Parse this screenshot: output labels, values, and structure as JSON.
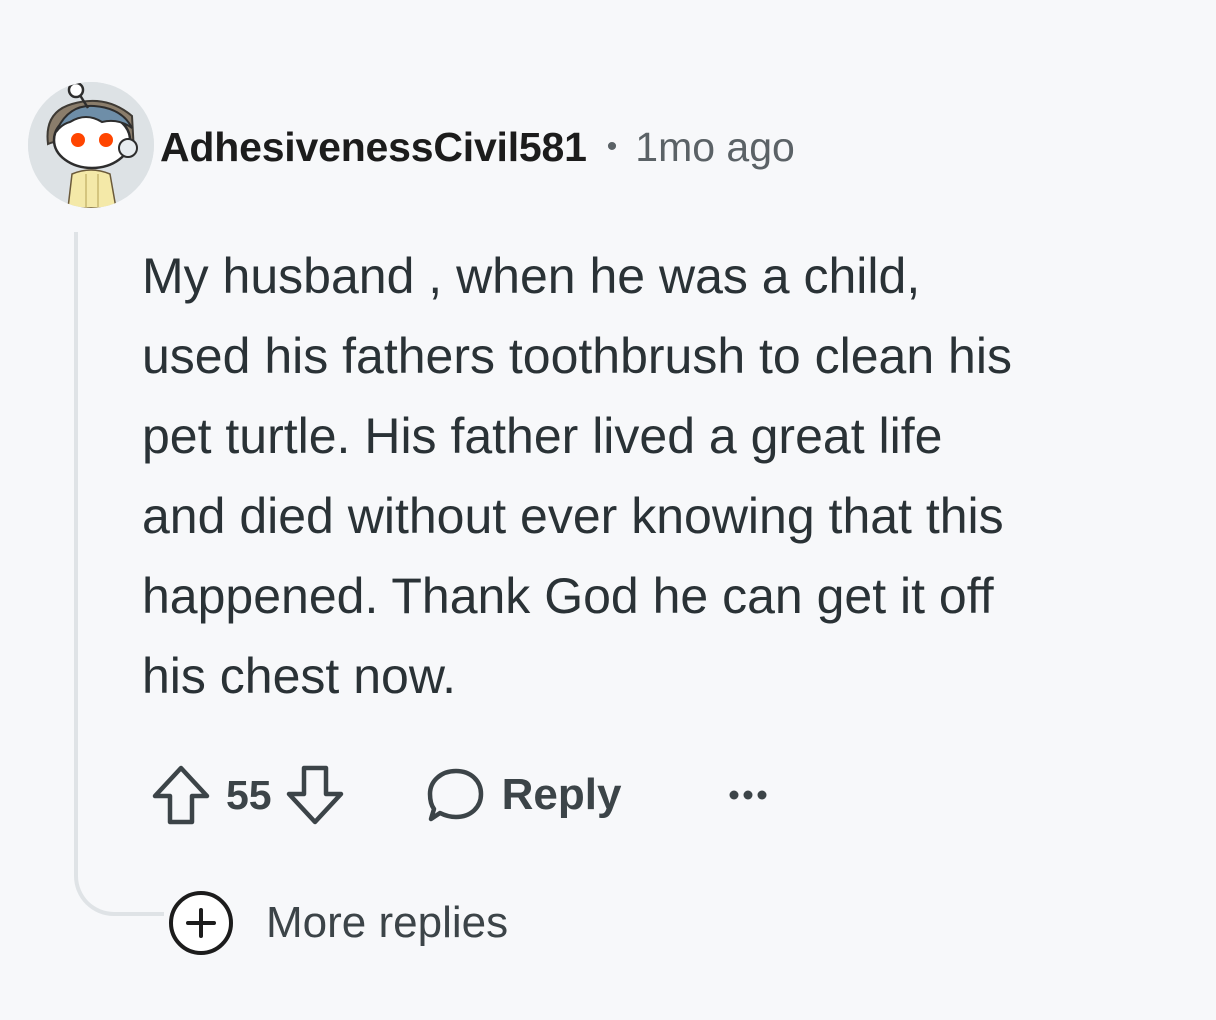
{
  "comment": {
    "username": "AdhesivenessCivil581",
    "separator": "•",
    "timestamp": "1mo ago",
    "body_lines": [
      "My husband , when he was a child,",
      "used his fathers toothbrush to clean his",
      "pet turtle. His father lived a great life",
      "and died without ever knowing that this",
      "happened. Thank God he can get it off",
      "his chest now."
    ]
  },
  "actions": {
    "vote_count": "55",
    "reply_label": "Reply",
    "upvote_icon": "arrow-up-icon",
    "downvote_icon": "arrow-down-icon",
    "reply_icon": "speech-bubble-icon",
    "more_icon": "ellipsis-icon"
  },
  "thread": {
    "more_replies_label": "More replies",
    "expand_icon": "plus-circle-icon"
  },
  "colors": {
    "background": "#f7f8fa",
    "text": "#2a3236",
    "muted": "#5b6266",
    "thread_line": "#dfe3e6"
  }
}
